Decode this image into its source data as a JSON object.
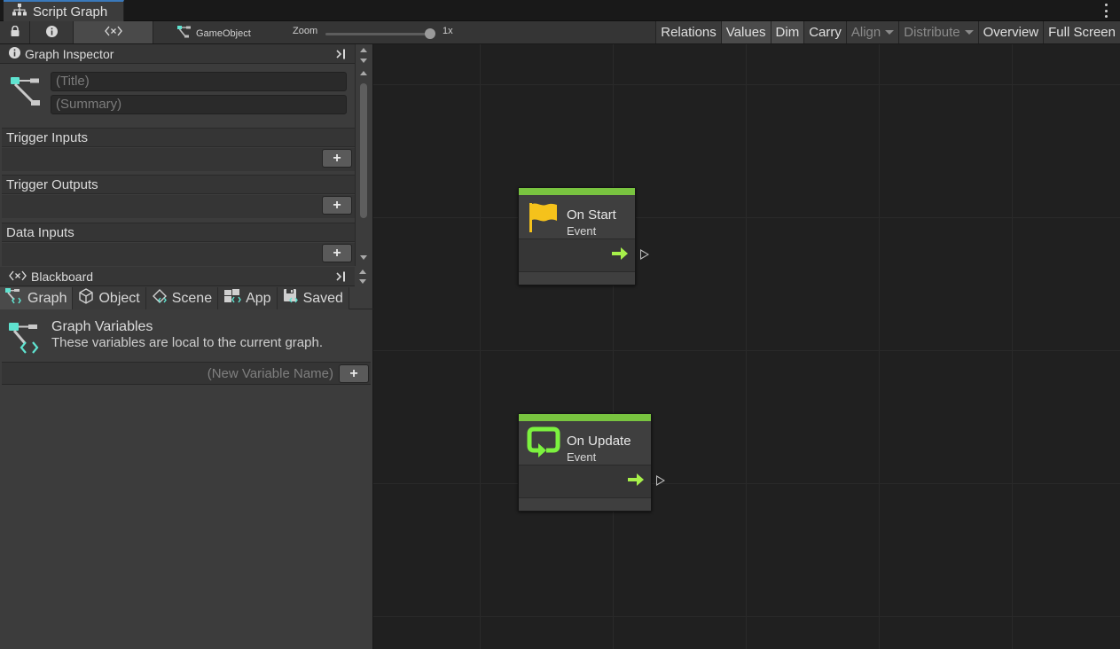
{
  "window": {
    "tab_title": "Script Graph"
  },
  "toolbar": {
    "context_label": "GameObject",
    "zoom_label": "Zoom",
    "zoom_value": "1x",
    "zoom_level": 1.0,
    "buttons": [
      {
        "label": "Relations",
        "state": "normal"
      },
      {
        "label": "Values",
        "state": "on"
      },
      {
        "label": "Dim",
        "state": "on"
      },
      {
        "label": "Carry",
        "state": "normal"
      },
      {
        "label": "Align",
        "state": "disabled",
        "dropdown": true
      },
      {
        "label": "Distribute",
        "state": "disabled",
        "dropdown": true
      },
      {
        "label": "Overview",
        "state": "normal"
      },
      {
        "label": "Full Screen",
        "state": "normal"
      }
    ]
  },
  "inspector": {
    "header": "Graph Inspector",
    "title_placeholder": "(Title)",
    "summary_placeholder": "(Summary)",
    "sections": {
      "trigger_inputs": "Trigger Inputs",
      "trigger_outputs": "Trigger Outputs",
      "data_inputs": "Data Inputs"
    },
    "add_symbol": "+"
  },
  "blackboard": {
    "header": "Blackboard",
    "tabs": {
      "graph": "Graph",
      "object": "Object",
      "scene": "Scene",
      "app": "App",
      "saved": "Saved"
    },
    "active_tab": "Graph",
    "section_title": "Graph Variables",
    "section_desc": "These variables are local to the current graph.",
    "new_var_placeholder": "(New Variable Name)",
    "add_symbol": "+"
  },
  "nodes": {
    "on_start": {
      "title": "On Start",
      "subtitle": "Event"
    },
    "on_update": {
      "title": "On Update",
      "subtitle": "Event"
    }
  },
  "colors": {
    "accent_green": "#79c440",
    "arrow_green": "#a7f04a",
    "flag_yellow": "#f5c21b",
    "graph_icon_cyan": "#5fe3d0",
    "background": "#202020"
  }
}
